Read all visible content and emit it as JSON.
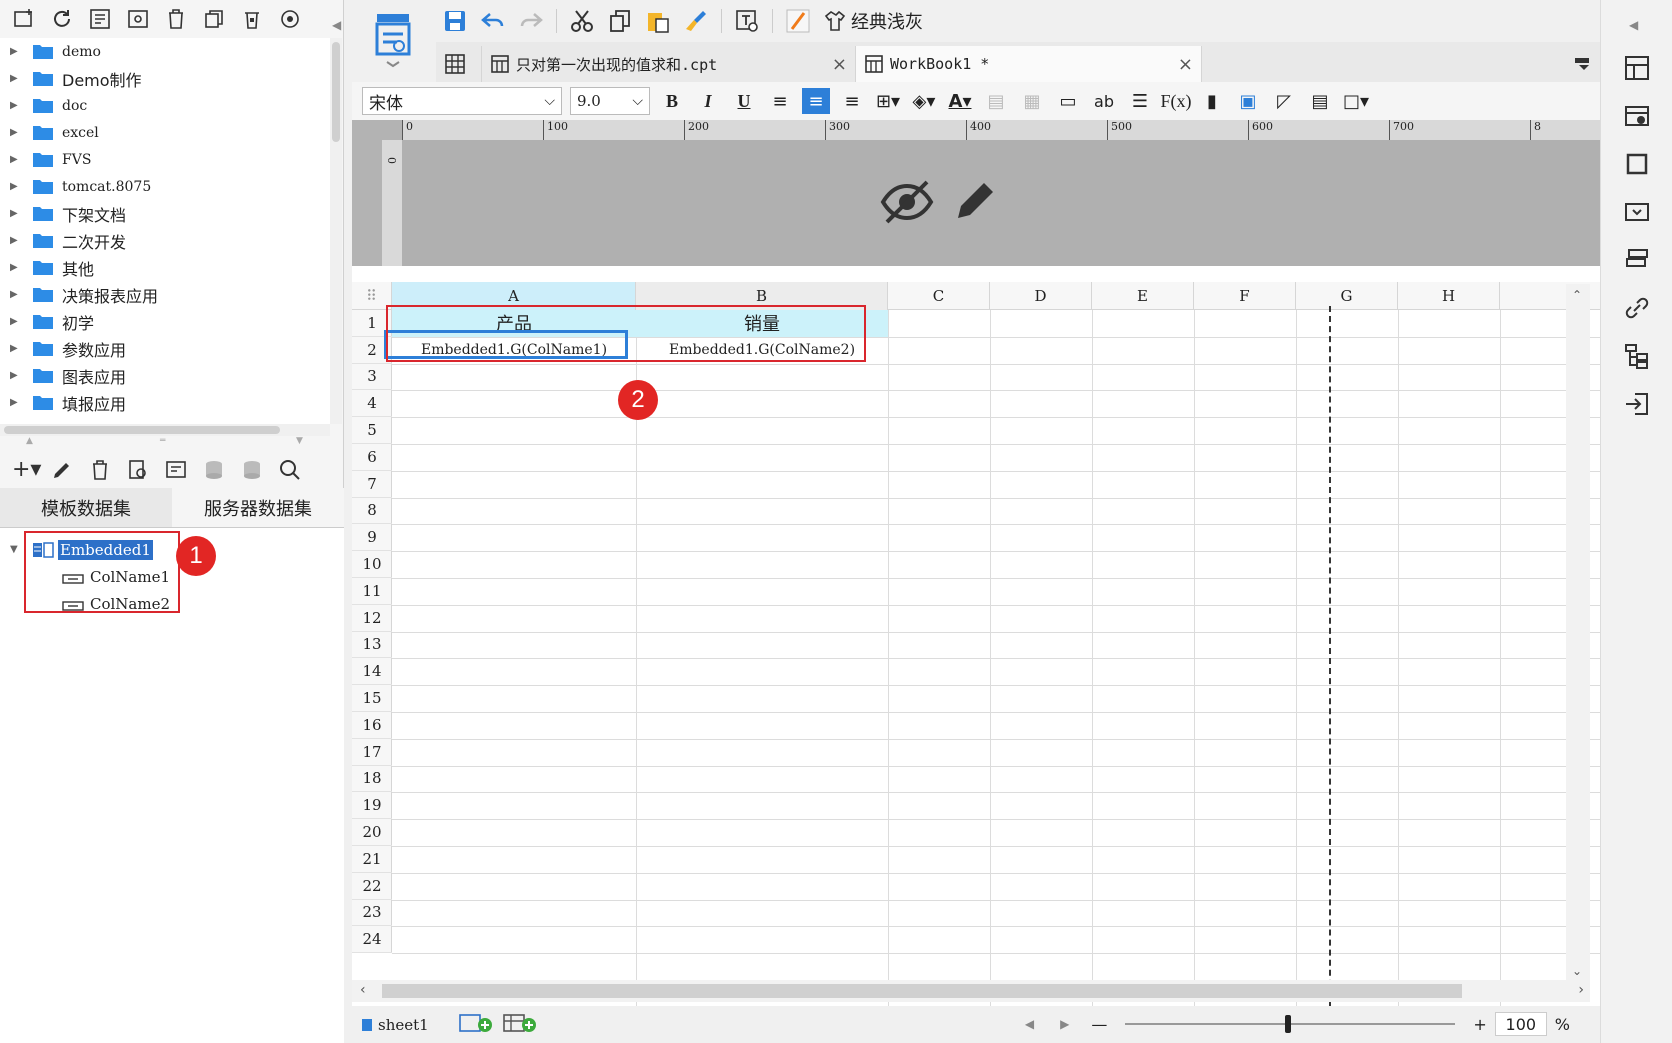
{
  "file_tree": {
    "items": [
      {
        "label": "demo",
        "mono": true
      },
      {
        "label": "Demo制作",
        "mono": false
      },
      {
        "label": "doc",
        "mono": true
      },
      {
        "label": "excel",
        "mono": true
      },
      {
        "label": "FVS",
        "mono": true
      },
      {
        "label": "tomcat.8075",
        "mono": true
      },
      {
        "label": "下架文档",
        "mono": false
      },
      {
        "label": "二次开发",
        "mono": false
      },
      {
        "label": "其他",
        "mono": false
      },
      {
        "label": "决策报表应用",
        "mono": false
      },
      {
        "label": "初学",
        "mono": false
      },
      {
        "label": "参数应用",
        "mono": false
      },
      {
        "label": "图表应用",
        "mono": false
      },
      {
        "label": "填报应用",
        "mono": false
      }
    ]
  },
  "dataset_tabs": {
    "template": "模板数据集",
    "server": "服务器数据集"
  },
  "dataset_tree": {
    "root": "Embedded1",
    "children": [
      "ColName1",
      "ColName2"
    ]
  },
  "annotations": {
    "one": "1",
    "two": "2"
  },
  "toolbar": {
    "skin_label": "经典浅灰"
  },
  "tabs": [
    {
      "label": "只对第一次出现的值求和.cpt",
      "close": "×"
    },
    {
      "label": "WorkBook1 *",
      "close": "×"
    }
  ],
  "format": {
    "font": "宋体",
    "size": "9.0"
  },
  "ruler": {
    "ticks": [
      "0",
      "100",
      "200",
      "300",
      "400",
      "500",
      "600",
      "700",
      "8"
    ],
    "vzero": "0"
  },
  "sheet": {
    "columns": [
      "A",
      "B",
      "C",
      "D",
      "E",
      "F",
      "G",
      "H"
    ],
    "rows": [
      "1",
      "2",
      "3",
      "4",
      "5",
      "6",
      "7",
      "8",
      "9",
      "10",
      "11",
      "12",
      "13",
      "14",
      "15",
      "16",
      "17",
      "18",
      "19",
      "20",
      "21",
      "22",
      "23",
      "24"
    ],
    "cells": {
      "A1": "产品",
      "B1": "销量",
      "A2": "Embedded1.G(ColName1)",
      "B2": "Embedded1.G(ColName2)"
    }
  },
  "status": {
    "sheet_name": "sheet1",
    "zoom": "100",
    "percent": "%",
    "minus": "—",
    "plus": "+"
  }
}
